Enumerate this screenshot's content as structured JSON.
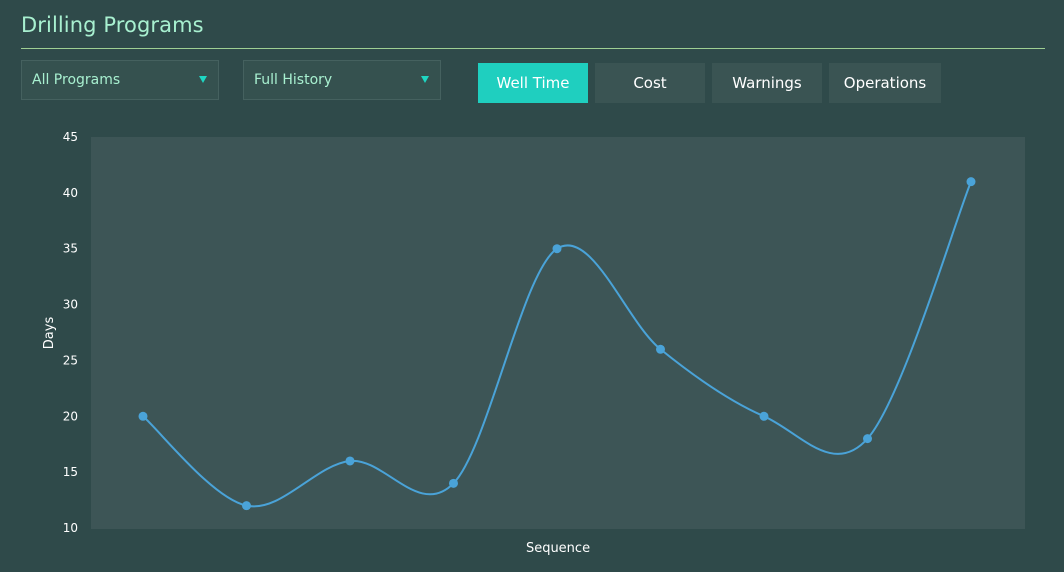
{
  "header": {
    "title": "Drilling Programs"
  },
  "filters": {
    "program": "All Programs",
    "history": "Full History"
  },
  "tabs": [
    {
      "label": "Well Time",
      "active": true
    },
    {
      "label": "Cost",
      "active": false
    },
    {
      "label": "Warnings",
      "active": false
    },
    {
      "label": "Operations",
      "active": false
    }
  ],
  "colors": {
    "accent": "#1fcfbf",
    "title": "#a8f0d0",
    "line": "#4aa3d8",
    "background": "#2f4a4a",
    "plot_background": "#3d5556"
  },
  "chart_data": {
    "type": "line",
    "title": "",
    "xlabel": "Sequence",
    "ylabel": "Days",
    "ylim": [
      10,
      45
    ],
    "yticks": [
      10,
      15,
      20,
      25,
      30,
      35,
      40,
      45
    ],
    "x": [
      1,
      2,
      3,
      4,
      5,
      6,
      7,
      8,
      9
    ],
    "series": [
      {
        "values": [
          20,
          12,
          16,
          14,
          35,
          26,
          20,
          18,
          41
        ]
      }
    ],
    "smooth": true,
    "grid": false
  }
}
